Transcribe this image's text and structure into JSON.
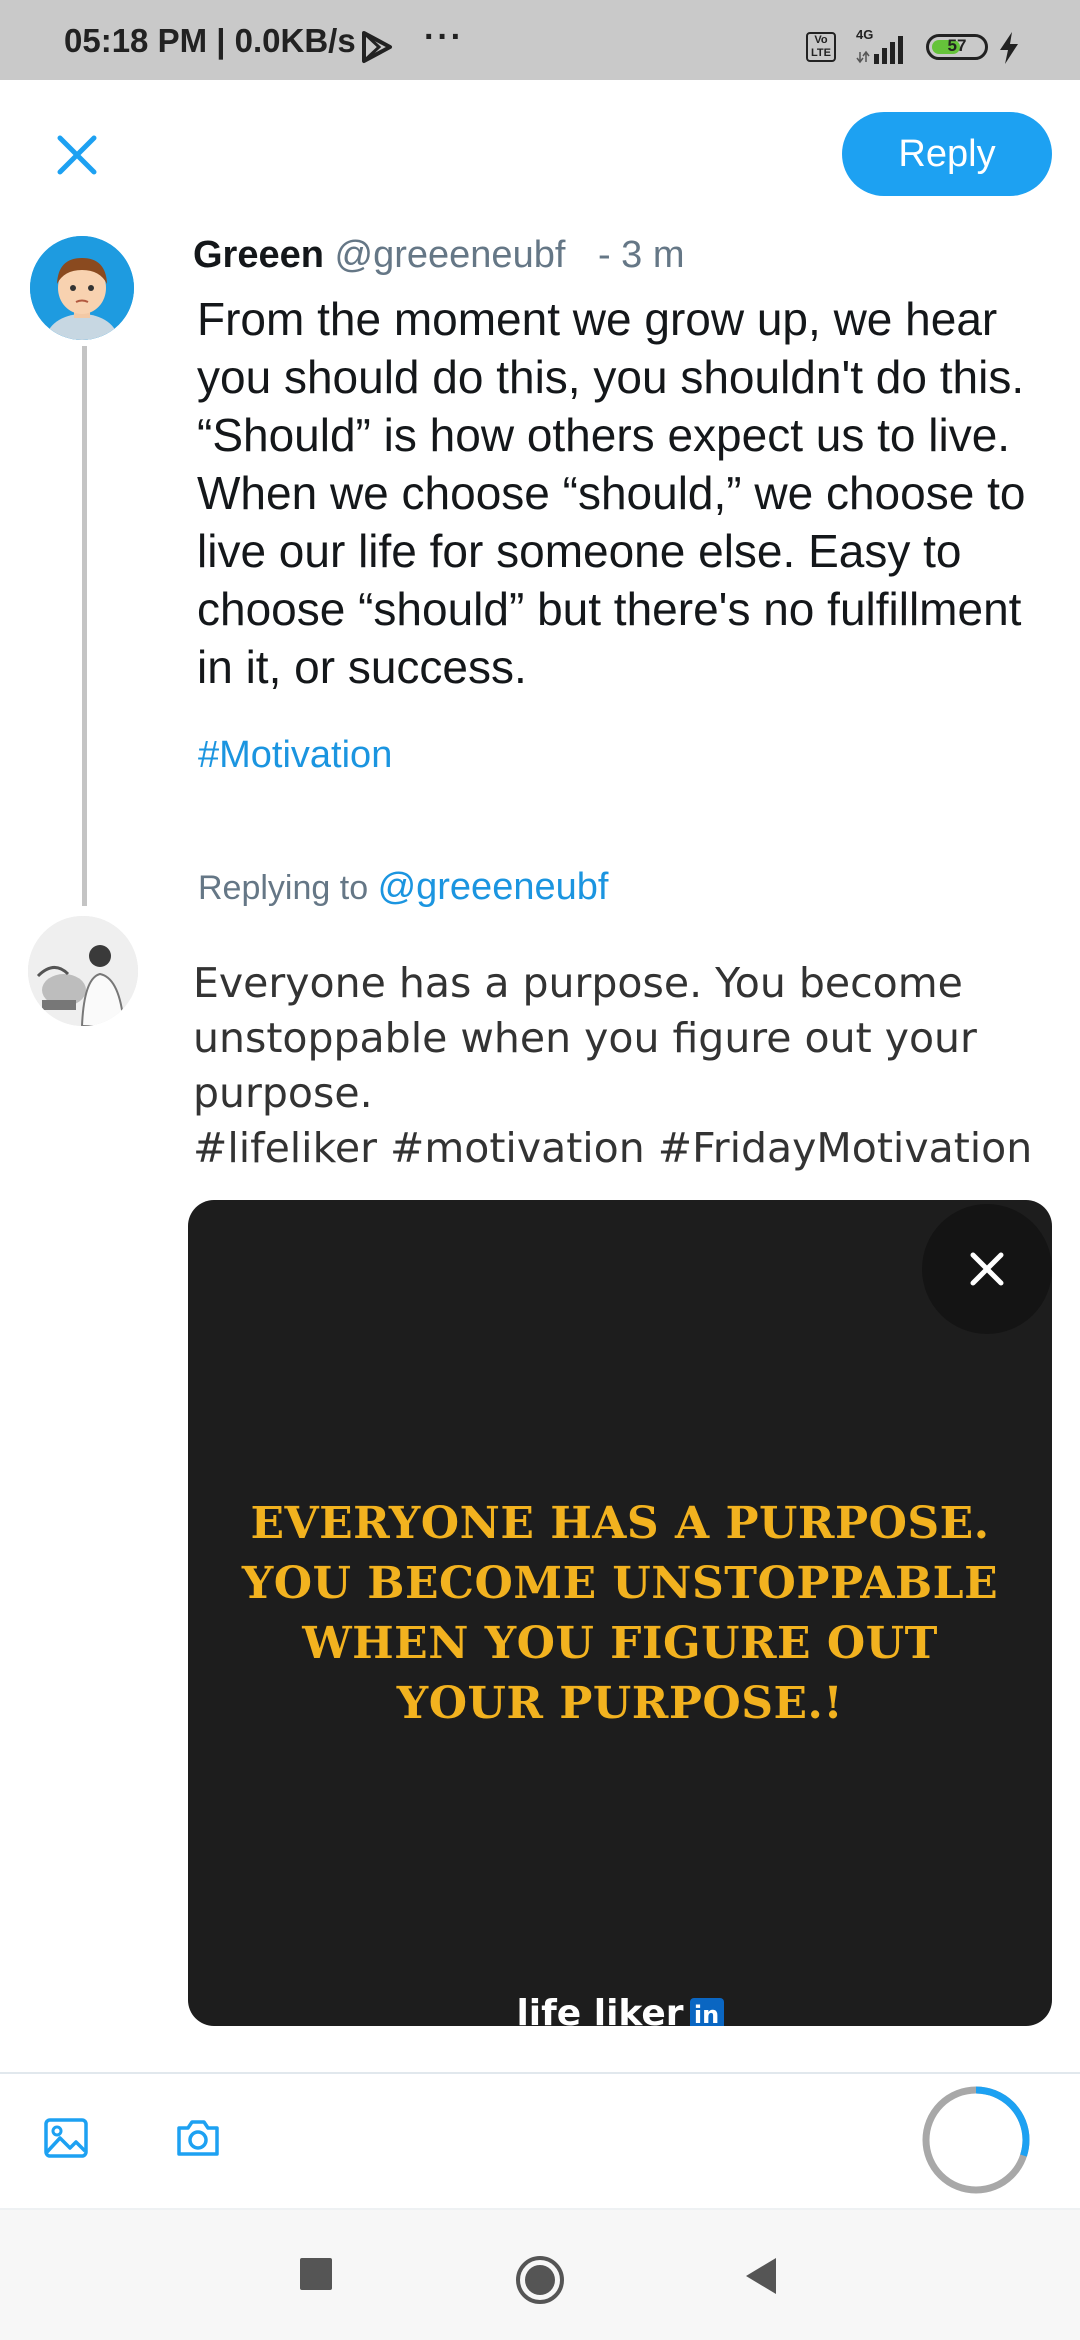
{
  "status_bar": {
    "time": "05:18 PM | 0.0KB/s",
    "more": "···",
    "volte": "Vo LTE",
    "network": "4G",
    "battery": "57",
    "battery_level": 0.57
  },
  "header": {
    "reply_label": "Reply"
  },
  "tweet": {
    "name": "Greeen",
    "handle": "@greeeneubf",
    "time": "- 3 m",
    "text": "From the moment we grow up, we hear you should do this, you shouldn't do this. “Should” is how others expect us to live. When we choose “should,” we choose to live our life for someone else. Easy to choose “should” but there's no fulfillment in it, or success.",
    "hashtag": "#Motivation"
  },
  "reply": {
    "replying_to_label": "Replying to",
    "replying_to_handle": "@greeeneubf",
    "text_line1": "Everyone has a purpose. You become unstoppable when you figure out your purpose.",
    "text_line2": "#lifeliker #motivation #FridayMotivation"
  },
  "media": {
    "quote": "EVERYONE HAS A PURPOSE. YOU BECOME UNSTOPPABLE WHEN YOU FIGURE OUT YOUR PURPOSE.!",
    "brand": "life liker",
    "brand_badge": "in"
  },
  "toolbar": {
    "char_progress": 0.3
  },
  "colors": {
    "accent": "#1da1f2",
    "quote_gold": "#f2b21f",
    "media_bg": "#1d1d1d"
  }
}
